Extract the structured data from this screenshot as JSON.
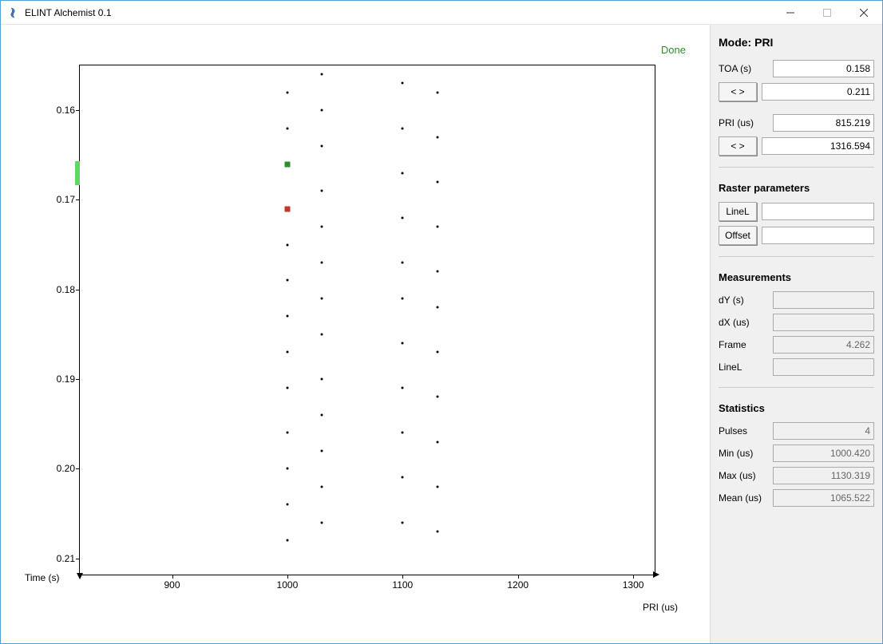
{
  "window": {
    "title": "ELINT Alchemist 0.1"
  },
  "status": "Done",
  "chart_data": {
    "type": "scatter",
    "xlabel": "PRI (us)",
    "ylabel": "Time (s)",
    "xlim": [
      820,
      1320
    ],
    "ylim_top": 0.155,
    "ylim_bottom": 0.212,
    "xticks": [
      900,
      1000,
      1100,
      1200,
      1300
    ],
    "yticks": [
      0.16,
      0.17,
      0.18,
      0.19,
      0.2,
      0.21
    ],
    "series": [
      {
        "name": "pulses",
        "points": [
          [
            1000,
            0.158
          ],
          [
            1000,
            0.162
          ],
          [
            1000,
            0.166
          ],
          [
            1000,
            0.171
          ],
          [
            1000,
            0.175
          ],
          [
            1000,
            0.179
          ],
          [
            1000,
            0.183
          ],
          [
            1000,
            0.187
          ],
          [
            1000,
            0.191
          ],
          [
            1000,
            0.196
          ],
          [
            1000,
            0.2
          ],
          [
            1000,
            0.204
          ],
          [
            1000,
            0.208
          ],
          [
            1030,
            0.156
          ],
          [
            1030,
            0.16
          ],
          [
            1030,
            0.164
          ],
          [
            1030,
            0.169
          ],
          [
            1030,
            0.173
          ],
          [
            1030,
            0.177
          ],
          [
            1030,
            0.181
          ],
          [
            1030,
            0.185
          ],
          [
            1030,
            0.19
          ],
          [
            1030,
            0.194
          ],
          [
            1030,
            0.198
          ],
          [
            1030,
            0.202
          ],
          [
            1030,
            0.206
          ],
          [
            1100,
            0.157
          ],
          [
            1100,
            0.162
          ],
          [
            1100,
            0.167
          ],
          [
            1100,
            0.172
          ],
          [
            1100,
            0.177
          ],
          [
            1100,
            0.181
          ],
          [
            1100,
            0.186
          ],
          [
            1100,
            0.191
          ],
          [
            1100,
            0.196
          ],
          [
            1100,
            0.201
          ],
          [
            1100,
            0.206
          ],
          [
            1130,
            0.158
          ],
          [
            1130,
            0.163
          ],
          [
            1130,
            0.168
          ],
          [
            1130,
            0.173
          ],
          [
            1130,
            0.178
          ],
          [
            1130,
            0.182
          ],
          [
            1130,
            0.187
          ],
          [
            1130,
            0.192
          ],
          [
            1130,
            0.197
          ],
          [
            1130,
            0.202
          ],
          [
            1130,
            0.207
          ]
        ]
      }
    ],
    "markers": [
      {
        "name": "green",
        "x": 1000,
        "y": 0.166
      },
      {
        "name": "red",
        "x": 1000,
        "y": 0.171
      }
    ],
    "y_highlight": 0.167
  },
  "side": {
    "mode_label": "Mode: PRI",
    "toa_label": "TOA (s)",
    "toa_from": "0.158",
    "toa_to": "0.211",
    "pri_label": "PRI (us)",
    "pri_from": "815.219",
    "pri_to": "1316.594",
    "nav_btn": "< >",
    "raster_title": "Raster parameters",
    "linel_btn": "LineL",
    "linel_val": "",
    "offset_btn": "Offset",
    "offset_val": "",
    "meas_title": "Measurements",
    "dy_label": "dY (s)",
    "dy_val": "",
    "dx_label": "dX (us)",
    "dx_val": "",
    "frame_label": "Frame",
    "frame_val": "4.262",
    "mlinel_label": "LineL",
    "mlinel_val": "",
    "stats_title": "Statistics",
    "pulses_label": "Pulses",
    "pulses_val": "4",
    "min_label": "Min (us)",
    "min_val": "1000.420",
    "max_label": "Max (us)",
    "max_val": "1130.319",
    "mean_label": "Mean (us)",
    "mean_val": "1065.522"
  }
}
